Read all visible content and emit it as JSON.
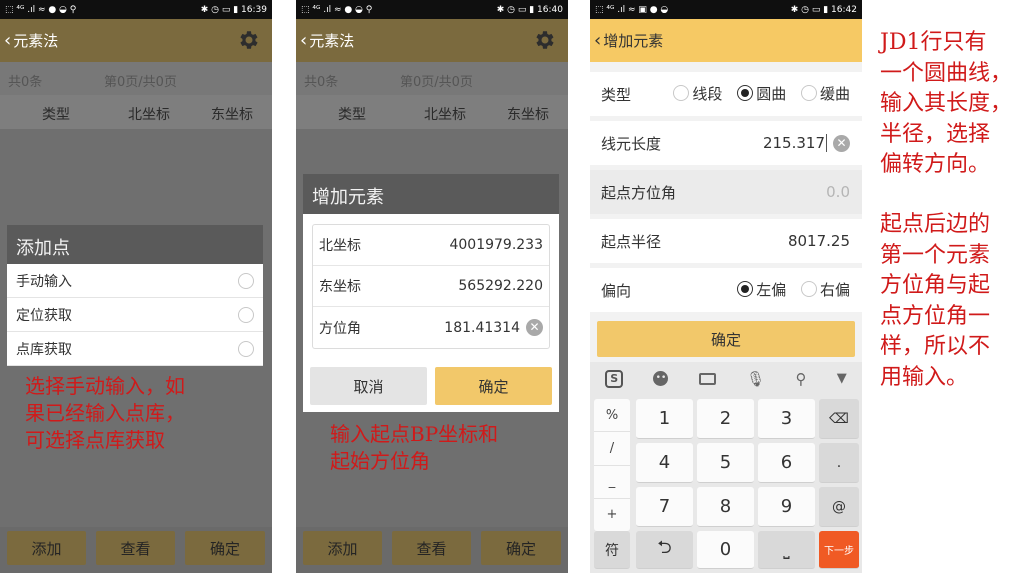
{
  "phone1": {
    "status": {
      "left": "⬚ ⁴ᴳ .ıl ≈ ● ◒ ⚲",
      "right": "✱ ◷ ▭ ▮ 16:39"
    },
    "app_title": "元素法",
    "info": {
      "count": "共0条",
      "pages": "第0页/共0页"
    },
    "columns": [
      "类型",
      "北坐标",
      "东坐标"
    ],
    "dialog": {
      "title": "添加点",
      "options": [
        "手动输入",
        "定位获取",
        "点库获取"
      ]
    },
    "buttons": {
      "add": "添加",
      "view": "查看",
      "confirm": "确定"
    },
    "annotation": [
      "选择手动输入，如",
      "果已经输入点库，",
      "可选择点库获取"
    ]
  },
  "phone2": {
    "status": {
      "left": "⬚ ⁴ᴳ .ıl ≈ ● ◒ ⚲",
      "right": "✱ ◷ ▭ ▮ 16:40"
    },
    "app_title": "元素法",
    "info": {
      "count": "共0条",
      "pages": "第0页/共0页"
    },
    "columns": [
      "类型",
      "北坐标",
      "东坐标"
    ],
    "dialog": {
      "title": "增加元素",
      "fields": [
        {
          "label": "北坐标",
          "value": "4001979.233"
        },
        {
          "label": "东坐标",
          "value": "565292.220"
        },
        {
          "label": "方位角",
          "value": "181.41314"
        }
      ],
      "cancel": "取消",
      "confirm": "确定"
    },
    "buttons": {
      "add": "添加",
      "view": "查看",
      "confirm": "确定"
    },
    "annotation": [
      "输入起点BP坐标和",
      "起始方位角"
    ]
  },
  "phone3": {
    "status": {
      "left": "⬚ ⁴ᴳ .ıl ≈ ▣ ● ◒",
      "right": "✱ ◷ ▭ ▮ 16:42"
    },
    "app_title": "增加元素",
    "type_row": {
      "label": "类型",
      "options": [
        "线段",
        "圆曲",
        "缓曲"
      ],
      "selected": "圆曲"
    },
    "length_row": {
      "label": "线元长度",
      "value": "215.317"
    },
    "azimuth_row": {
      "label": "起点方位角",
      "placeholder": "0.0"
    },
    "radius_row": {
      "label": "起点半径",
      "value": "8017.25"
    },
    "direction_row": {
      "label": "偏向",
      "options": [
        "左偏",
        "右偏"
      ],
      "selected": "左偏"
    },
    "confirm": "确定",
    "keyboard": {
      "symbols": [
        "%",
        "/",
        "_",
        "+"
      ],
      "digits": [
        "1",
        "2",
        "3",
        "4",
        "5",
        "6",
        "7",
        "8",
        "9",
        "0"
      ],
      "dot": ".",
      "at": "@",
      "fu": "符",
      "next": "下一步"
    }
  },
  "annotation_right": {
    "para1": [
      "JD1行只有",
      "一个圆曲线，",
      "输入其长度，",
      "半径，选择",
      "偏转方向。"
    ],
    "para2": [
      "起点后边的",
      "第一个元素",
      "方位角与起",
      "点方位角一",
      "样，所以不",
      "用输入。"
    ]
  },
  "colors": {
    "appbar_dim": "#7b6a3e",
    "appbar": "#f6c964",
    "button": "#f2c86a",
    "annotation": "#d01a1a",
    "next_key": "#f05a24"
  },
  "icons": [
    "back-chevron-icon",
    "gear-icon",
    "radio-icon",
    "clear-icon",
    "sogou-logo-icon",
    "emoji-icon",
    "keyboard-icon",
    "microphone-icon",
    "search-icon",
    "collapse-keyboard-icon",
    "backspace-icon",
    "undo-icon",
    "space-icon"
  ]
}
